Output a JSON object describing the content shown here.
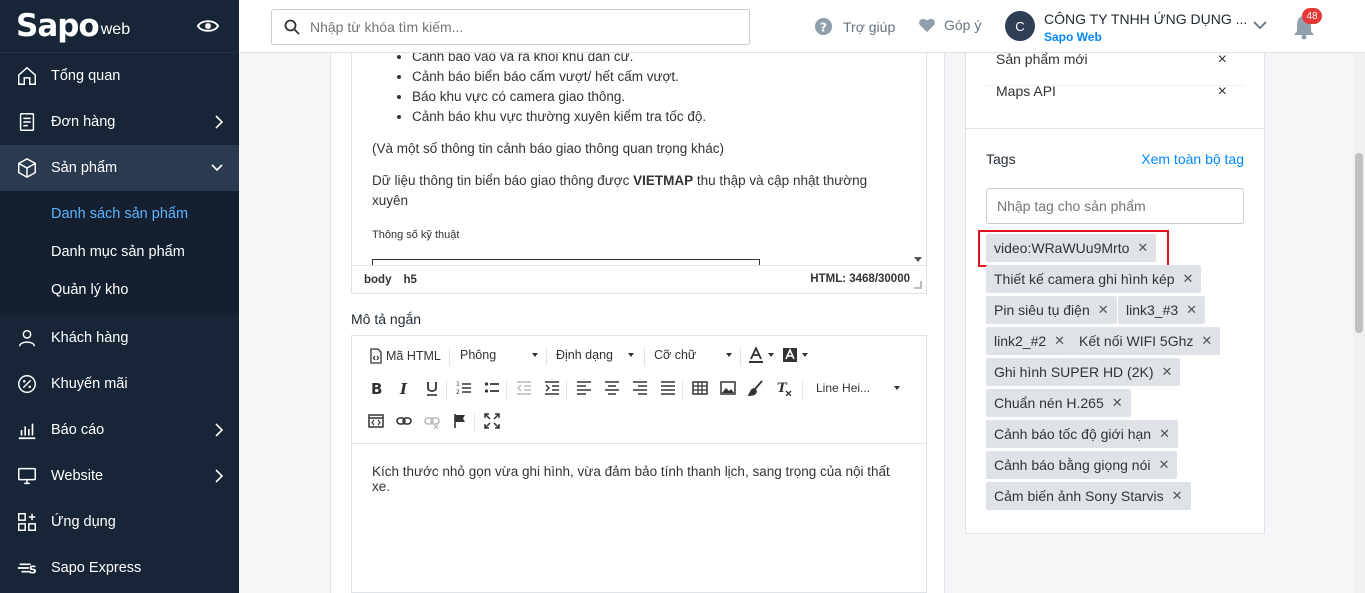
{
  "brand": {
    "name": "Sapo",
    "suffix": "web"
  },
  "sidebar": {
    "items": [
      {
        "label": "Tổng quan",
        "icon": "home-icon"
      },
      {
        "label": "Đơn hàng",
        "icon": "order-icon"
      },
      {
        "label": "Sản phẩm",
        "icon": "box-icon"
      },
      {
        "label": "Khách hàng",
        "icon": "user-icon"
      },
      {
        "label": "Khuyến mãi",
        "icon": "percent-icon"
      },
      {
        "label": "Báo cáo",
        "icon": "chart-icon"
      },
      {
        "label": "Website",
        "icon": "monitor-icon"
      },
      {
        "label": "Ứng dụng",
        "icon": "apps-icon"
      },
      {
        "label": "Sapo Express",
        "icon": "express-icon"
      }
    ],
    "subitems": [
      "Danh sách sản phẩm",
      "Danh mục sản phẩm",
      "Quản lý kho"
    ]
  },
  "topbar": {
    "search_placeholder": "Nhập từ khóa tìm kiếm...",
    "help": "Trợ giúp",
    "feedback": "Góp ý",
    "avatar_letter": "C",
    "company": "CÔNG TY TNHH ỨNG DỤNG ...",
    "company_sub": "Sapo Web",
    "notifications": "48"
  },
  "editor1": {
    "bullets": [
      "Cảnh báo vào và ra khỏi khu dân cư.",
      "Cảnh báo biển báo cấm vượt/ hết cấm vượt.",
      "Báo khu vực có camera giao thông.",
      "Cảnh báo khu vực thường xuyên kiểm tra tốc độ."
    ],
    "para1": "(Và một số thông tin cảnh báo giao thông quan trọng khác)",
    "para2_a": "Dữ liệu thông tin biển báo giao thông được ",
    "para2_b": "VIETMAP",
    "para2_c": " thu thập và cập nhật thường xuyên",
    "small": "Thông số kỹ thuật",
    "path_body": "body",
    "path_h5": "h5",
    "html_count": "HTML: 3468/30000"
  },
  "short_desc": {
    "label": "Mô tả ngắn",
    "toolbar": {
      "html": "Mã HTML",
      "font": "Phông",
      "format": "Định dạng",
      "size": "Cỡ chữ",
      "lineheight": "Line Hei..."
    },
    "content": "Kích thước nhỏ gọn vừa ghi hình, vừa đảm bảo tính thanh lịch, sang trọng của nội thất xe."
  },
  "right": {
    "collections": [
      "Sản phẩm mới",
      "Maps API"
    ],
    "tags_label": "Tags",
    "tags_link": "Xem toàn bộ tag",
    "tag_placeholder": "Nhập tag cho sản phẩm",
    "tags": [
      "video:WRaWUu9Mrto",
      "Thiết kế camera ghi hình kép",
      "Pin siêu tụ điện",
      "link3_#3",
      "link2_#2",
      "Kết nối WIFI 5Ghz",
      "Ghi hình SUPER HD (2K)",
      "Chuẩn nén H.265",
      "Cảnh báo tốc độ giới hạn",
      "Cảnh báo bằng giọng nói",
      "Cảm biến ảnh Sony Starvis"
    ]
  },
  "colors": {
    "sidebar": "#182537",
    "accent": "#0088ff",
    "highlight": "#e0141e",
    "badge": "#e53935"
  }
}
